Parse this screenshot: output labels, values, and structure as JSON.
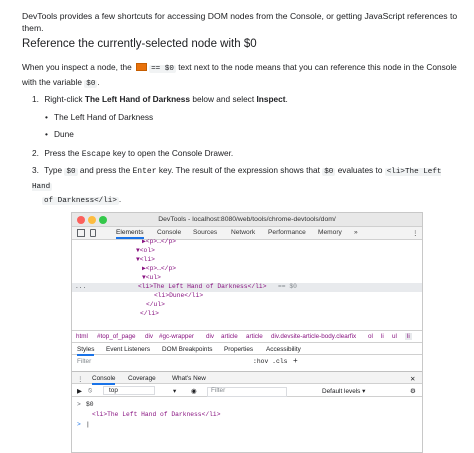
{
  "doc": {
    "intro": "DevTools provides a few shortcuts for accessing DOM nodes from the Console, or getting JavaScript references to them.",
    "heading": "Reference the currently-selected node with $0",
    "p1_pre": "When you inspect a node, the",
    "p1_code": "== $0",
    "p1_mid": "text next to the node means that you can reference this node in the Console with the variable",
    "p1_var": "$0",
    "p1_end": ".",
    "step1_num": "1.",
    "step1_pre": "Right-click",
    "step1_bold": "The Left Hand of Darkness",
    "step1_mid": "below and select",
    "step1_bold2": "Inspect",
    "step1_end": ".",
    "bullets": [
      "The Left Hand of Darkness",
      "Dune"
    ],
    "step2_num": "2.",
    "step2_pre": "Press the",
    "step2_key": "Escape",
    "step2_end": "key to open the Console Drawer.",
    "step3_num": "3.",
    "step3_pre": "Type",
    "step3_code": "$0",
    "step3_mid": "and press the",
    "step3_key": "Enter",
    "step3_mid2": "key. The result of the expression shows that",
    "step3_code2": "$0",
    "step3_mid3": "evaluates to",
    "step3_code3a": "<li>The Left Hand",
    "step3_code3b": "of Darkness</li>",
    "step3_end": "."
  },
  "devtools": {
    "title": "DevTools - localhost:8080/web/tools/chrome-devtools/dom/",
    "tabs": [
      "Elements",
      "Console",
      "Sources",
      "Network",
      "Performance",
      "Memory",
      "»"
    ],
    "menu_label": "⋮",
    "dom_lines": [
      "▶<p>…</p>",
      "▼<ol>",
      "▼<li>",
      "▶<p>…</p>",
      "▼<ul>",
      "<li>The Left Hand of Darkness</li>",
      "== $0",
      "<li>Dune</li>",
      "</ul>",
      "</li>"
    ],
    "gutter_dots": "...",
    "breadcrumbs": [
      "html",
      "#top_of_page",
      "div",
      "#gc-wrapper",
      "div",
      "article",
      "article",
      "div.devsite-article-body.clearfix",
      "ol",
      "li",
      "ul",
      "li"
    ],
    "panel_tabs": [
      "Styles",
      "Event Listeners",
      "DOM Breakpoints",
      "Properties",
      "Accessibility"
    ],
    "filter_placeholder": "Filter",
    "hov_cls": ":hov  .cls",
    "plus": "+",
    "drawer_tabs": [
      "Console",
      "Coverage",
      "What's New"
    ],
    "drawer_close": "✕",
    "context": "top",
    "console_filter": "Filter",
    "levels": "Default levels ▾",
    "console_lines": [
      {
        "prefix": ">",
        "text": "$0"
      },
      {
        "prefix": "",
        "text": "<li>The Left Hand of Darkness</li>"
      },
      {
        "prefix": ">",
        "text": "|"
      }
    ]
  }
}
